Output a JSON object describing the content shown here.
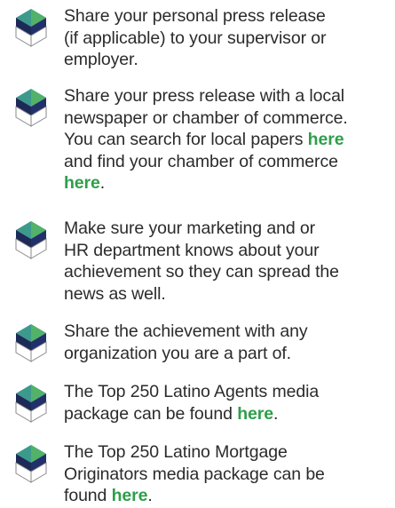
{
  "colors": {
    "link": "#2e9e4b",
    "text": "#2b2b2b",
    "bullet_teal": "#3c9a8c",
    "bullet_green": "#52b26a",
    "bullet_navy": "#1d2a57",
    "bullet_outline": "#8a8a8a"
  },
  "bullet_icon": "cube-bullet-icon",
  "items": [
    {
      "lines": [
        "Share your personal press release",
        "(if applicable) to your supervisor or",
        "employer."
      ]
    },
    {
      "line1": "Share your press release with a local",
      "line2": "newspaper or chamber of commerce.",
      "line3": "You can search for local papers ",
      "link1": "here",
      "line4": "and find your chamber of commerce",
      "link2": "here",
      "end": "."
    },
    {
      "lines": [
        "Make sure your marketing and or",
        "HR department knows about your",
        "achievement so they can spread the",
        "news as well."
      ]
    },
    {
      "lines": [
        "Share the achievement with any",
        "organization you are a part of."
      ]
    },
    {
      "line1": "The Top 250 Latino Agents media",
      "line2": "package can be found ",
      "link": "here",
      "end": "."
    },
    {
      "line1": "The Top 250 Latino Mortgage",
      "line2": "Originators media package can be",
      "line3": "found ",
      "link": "here",
      "end": "."
    }
  ]
}
